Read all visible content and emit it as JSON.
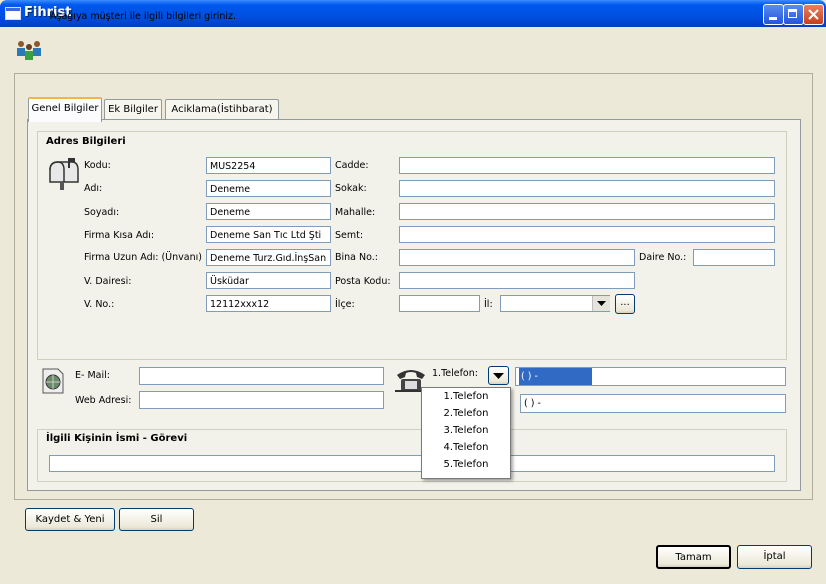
{
  "window": {
    "title": "Fihrist"
  },
  "header": {
    "instruction": "Aşağıya müşteri ile ilgili bilgileri giriniz."
  },
  "tabs": [
    {
      "label": "Genel Bilgiler"
    },
    {
      "label": "Ek Bilgiler"
    },
    {
      "label": "Aciklama(İstihbarat)"
    }
  ],
  "address": {
    "title": "Adres Bilgileri",
    "kodu_label": "Kodu:",
    "kodu_value": "MUS2254",
    "adi_label": "Adı:",
    "adi_value": "Deneme",
    "soyadi_label": "Soyadı:",
    "soyadi_value": "Deneme",
    "firma_kisa_label": "Firma Kısa Adı:",
    "firma_kisa_value": "Deneme San Tıc Ltd Şti",
    "firma_uzun_label": "Firma Uzun Adı: (Ünvanı)",
    "firma_uzun_value": "Deneme Turz.Gıd.İnşSan",
    "vdairesi_label": "V. Dairesi:",
    "vdairesi_value": "Üsküdar",
    "vno_label": "V. No.:",
    "vno_value": "12112xxx12",
    "cadde_label": "Cadde:",
    "sokak_label": "Sokak:",
    "mahalle_label": "Mahalle:",
    "semt_label": "Semt:",
    "bina_label": "Bina No.:",
    "daire_label": "Daire No.:",
    "posta_label": "Posta Kodu:",
    "ilce_label": "İlçe:",
    "il_label": "İl:",
    "browse_label": "..."
  },
  "contact": {
    "email_label": "E- Mail:",
    "web_label": "Web Adresi:",
    "phone_label": "1.Telefon:",
    "phone1_value": "(   )  -",
    "phone2_value": "(   )  -",
    "phone_options": [
      "1.Telefon",
      "2.Telefon",
      "3.Telefon",
      "4.Telefon",
      "5.Telefon"
    ]
  },
  "person": {
    "title": "İlgili Kişinin İsmi - Görevi"
  },
  "buttons": {
    "kaydet": "Kaydet & Yeni",
    "sil": "Sil",
    "tamam": "Tamam",
    "iptal": "İptal"
  },
  "colors": {
    "accent": "#0054e3",
    "selection": "#316ac5",
    "tab_highlight": "#f8b248"
  }
}
